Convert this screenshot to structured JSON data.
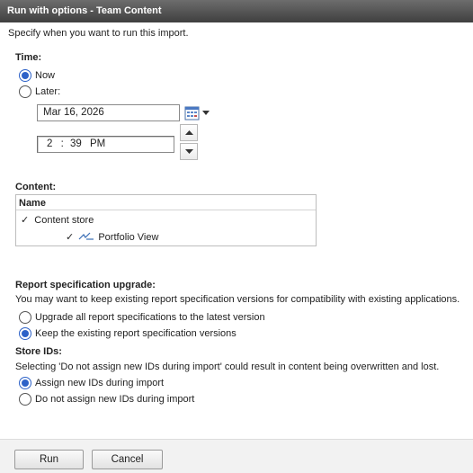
{
  "window": {
    "title": "Run with options - Team Content"
  },
  "intro": "Specify when you want to run this import.",
  "time": {
    "heading": "Time:",
    "now_label": "Now",
    "later_label": "Later:",
    "selected": "now",
    "date_value": "Mar 16, 2026",
    "time_hour": "2",
    "time_sep": ":",
    "time_minute": "39",
    "time_ampm": "PM"
  },
  "content": {
    "heading": "Content:",
    "column_header": "Name",
    "rows": [
      {
        "check": "✓",
        "label": "Content store"
      },
      {
        "check": "✓",
        "label": "Portfolio View"
      }
    ]
  },
  "report_spec": {
    "heading": "Report specification upgrade:",
    "description": "You may want to keep existing report specification versions for compatibility with existing applications.",
    "option_upgrade": "Upgrade all report specifications to the latest version",
    "option_keep": "Keep the existing report specification versions",
    "selected": "keep"
  },
  "store_ids": {
    "heading": "Store IDs:",
    "description": "Selecting 'Do not assign new IDs during import' could result in content being overwritten and lost.",
    "option_assign": "Assign new IDs during import",
    "option_no_assign": "Do not assign new IDs during import",
    "selected": "assign"
  },
  "footer": {
    "run_label": "Run",
    "cancel_label": "Cancel"
  },
  "colors": {
    "accent": "#2d62c8",
    "titlebar": "#4a4a4a"
  },
  "icons": [
    "calendar-icon",
    "chevron-down-icon",
    "spin-up-icon",
    "spin-down-icon",
    "checkmark-icon",
    "package-icon"
  ]
}
